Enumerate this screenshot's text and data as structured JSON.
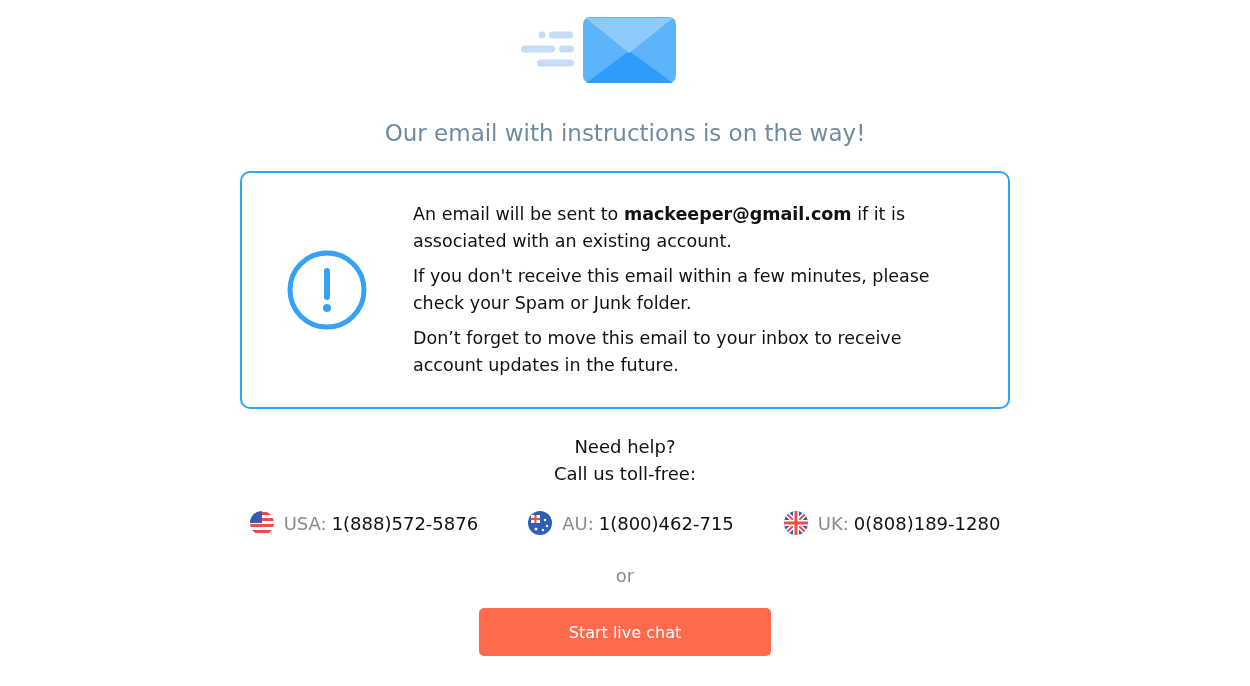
{
  "heading": "Our email with instructions is on the way!",
  "notice": {
    "paragraphs": [
      "An email will be sent to **mackeeper@gmail.com** if it is associated with an existing account.",
      "If you don't receive this email within a few minutes, please check your Spam or Junk folder.",
      "Don’t forget to move this email to your inbox to receive account updates in the future."
    ]
  },
  "help": {
    "lines": [
      "Need help?",
      "Call us toll-free:"
    ]
  },
  "phones": [
    {
      "kind": "usa",
      "label": "USA:",
      "number": "1(888)572-5876"
    },
    {
      "kind": "au",
      "label": "AU:",
      "number": "1(800)462-715"
    },
    {
      "kind": "uk",
      "label": "UK:",
      "number": "0(808)189-1280"
    }
  ],
  "separator": "or",
  "button": "Start live chat"
}
